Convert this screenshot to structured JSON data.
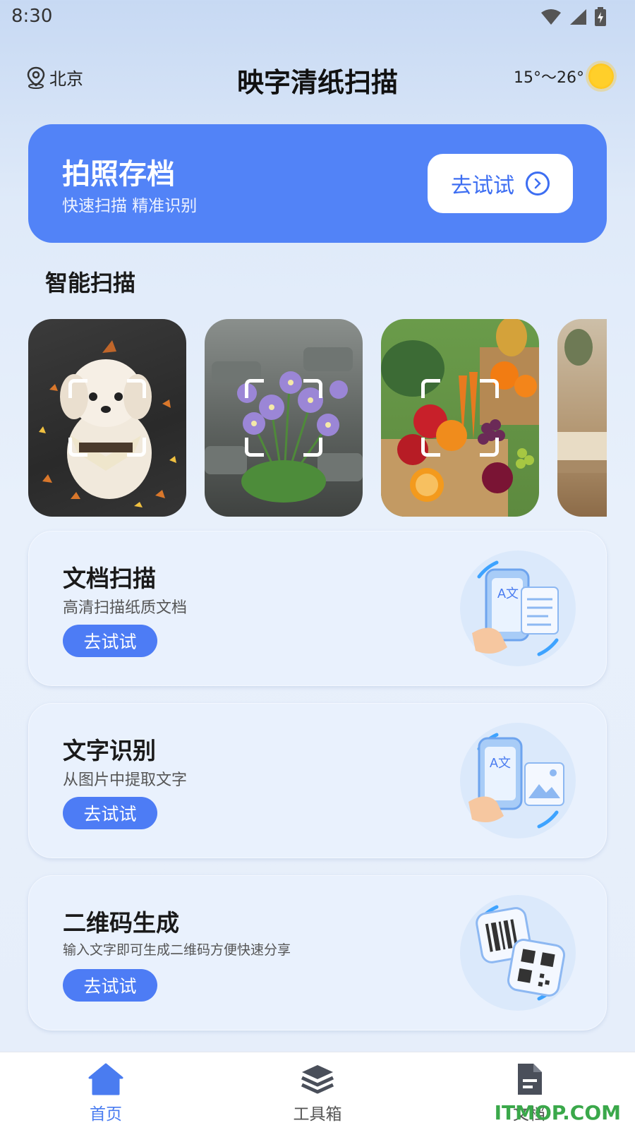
{
  "status_bar": {
    "time": "8:30"
  },
  "header": {
    "location": "北京",
    "title": "映字清纸扫描",
    "weather": "15°～26°"
  },
  "hero": {
    "title": "拍照存档",
    "subtitle": "快速扫描 精准识别",
    "button_label": "去试试"
  },
  "smart_scan": {
    "title": "智能扫描",
    "items": [
      "dog-photo",
      "flower-photo",
      "vegetables-photo",
      "book-photo"
    ]
  },
  "features": [
    {
      "title": "文档扫描",
      "subtitle": "高清扫描纸质文档",
      "button_label": "去试试"
    },
    {
      "title": "文字识别",
      "subtitle": "从图片中提取文字",
      "button_label": "去试试"
    },
    {
      "title": "二维码生成",
      "subtitle": "输入文字即可生成二维码方便快速分享",
      "button_label": "去试试"
    }
  ],
  "bottom_nav": {
    "items": [
      {
        "label": "首页",
        "icon": "home-icon",
        "active": true
      },
      {
        "label": "工具箱",
        "icon": "layers-icon",
        "active": false
      },
      {
        "label": "文档",
        "icon": "document-icon",
        "active": false
      }
    ]
  },
  "watermark": "ITMOP.COM",
  "colors": {
    "primary": "#5283f7",
    "button": "#4d7cf5",
    "nav_active": "#4a7cf0",
    "nav_inactive": "#555555"
  }
}
